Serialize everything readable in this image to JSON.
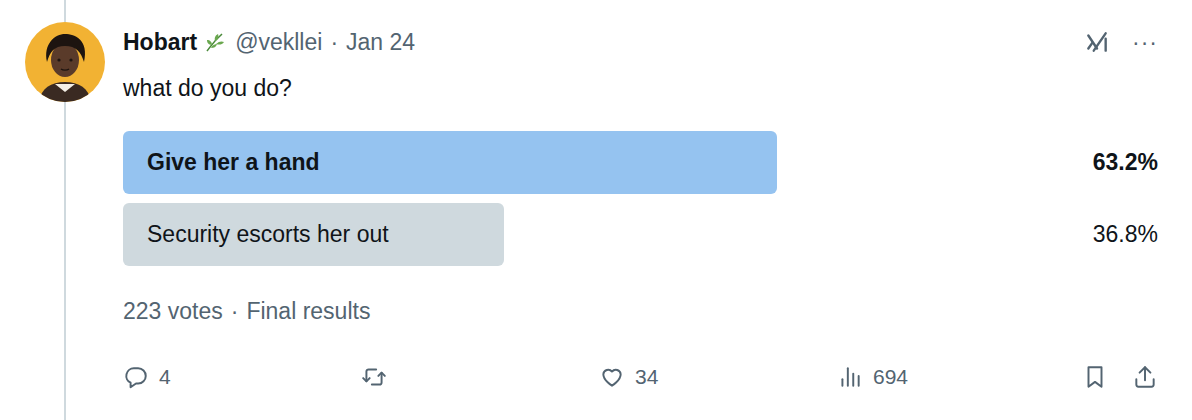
{
  "author": {
    "name": "Hobart",
    "handle": "@vekllei",
    "separator": "·",
    "date": "Jan 24"
  },
  "menu": "···",
  "tweet": {
    "text": "what do you do?"
  },
  "poll": {
    "options": [
      {
        "label": "Give her a hand",
        "percent": "63.2%",
        "level": 0.632,
        "selected": true
      },
      {
        "label": "Security escorts her out",
        "percent": "36.8%",
        "level": 0.368,
        "selected": false
      }
    ],
    "votes": "223 votes",
    "separator": "·",
    "status": "Final results"
  },
  "actions": [
    {
      "kind": "reply",
      "count": "4"
    },
    {
      "kind": "retweet"
    },
    {
      "kind": "like",
      "count": "34"
    },
    {
      "kind": "views",
      "count": "694"
    },
    {
      "kind": "bookmark"
    },
    {
      "kind": "share"
    }
  ]
}
